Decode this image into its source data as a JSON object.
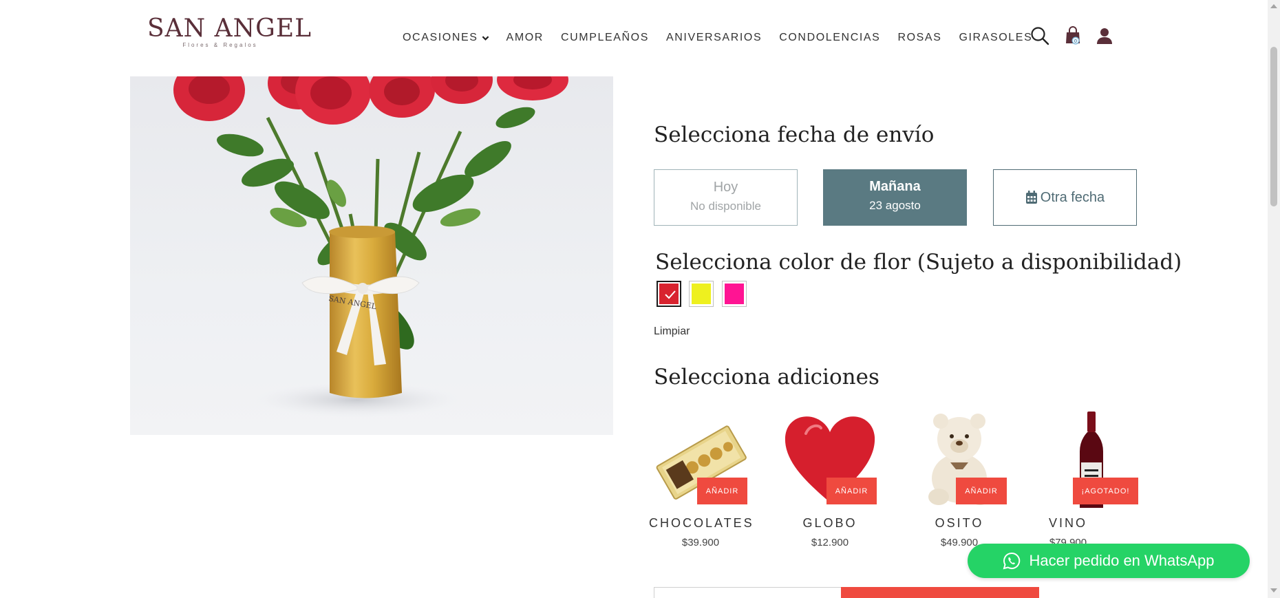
{
  "brand": {
    "name": "SAN ANGEL",
    "tagline": "Flores & Regalos",
    "color": "#5a2f39"
  },
  "nav": {
    "items": [
      {
        "label": "OCASIONES",
        "has_dropdown": true
      },
      {
        "label": "AMOR"
      },
      {
        "label": "CUMPLEAÑOS"
      },
      {
        "label": "ANIVERSARIOS"
      },
      {
        "label": "CONDOLENCIAS"
      },
      {
        "label": "ROSAS"
      },
      {
        "label": "GIRASOLES"
      }
    ],
    "icons": [
      "search-icon",
      "cart-icon",
      "user-icon"
    ],
    "cart_count": "0"
  },
  "product_image": {
    "ribbon_text": "SAN ANGEL"
  },
  "delivery": {
    "title": "Selecciona fecha de envío",
    "options": [
      {
        "label": "Hoy",
        "sublabel": "No disponible",
        "state": "disabled"
      },
      {
        "label": "Mañana",
        "sublabel": "23 agosto",
        "state": "selected"
      },
      {
        "label": "Otra fecha",
        "icon": "calendar-icon",
        "state": "available"
      }
    ]
  },
  "flower_color": {
    "title": "Selecciona color de flor (Sujeto a disponibilidad)",
    "swatches": [
      {
        "color": "#d8232f",
        "selected": true
      },
      {
        "color": "#eef01f",
        "selected": false
      },
      {
        "color": "#ff1493",
        "selected": false
      }
    ],
    "clear_label": "Limpiar"
  },
  "addons": {
    "title": "Selecciona adiciones",
    "items": [
      {
        "name": "CHOCOLATES",
        "price": "$39.900",
        "button": "AÑADIR"
      },
      {
        "name": "GLOBO",
        "price": "$12.900",
        "button": "AÑADIR"
      },
      {
        "name": "OSITO",
        "price": "$49.900",
        "button": "AÑADIR"
      },
      {
        "name": "VINO",
        "price": "$79.900",
        "button": "¡AGOTADO!"
      }
    ]
  },
  "whatsapp": {
    "label": "Hacer pedido en WhatsApp",
    "color": "#25d366"
  },
  "accent_color": "#ef4a3f"
}
